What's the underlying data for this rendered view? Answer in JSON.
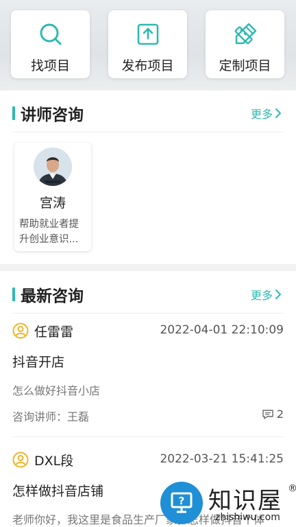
{
  "quick_actions": [
    {
      "label": "找项目",
      "icon": "search-icon"
    },
    {
      "label": "发布项目",
      "icon": "upload-icon"
    },
    {
      "label": "定制项目",
      "icon": "pencil-ruler-icon"
    }
  ],
  "teacher_section": {
    "title": "讲师咨询",
    "more_label": "更多",
    "teachers": [
      {
        "name": "宫涛",
        "desc": "帮助就业者提升创业意识..."
      }
    ]
  },
  "latest_section": {
    "title": "最新咨询",
    "more_label": "更多",
    "items": [
      {
        "user": "任雷雷",
        "time": "2022-04-01 22:10:09",
        "topic": "抖音开店",
        "desc": "怎么做好抖音小店",
        "teacher_line": "咨询讲师：王磊",
        "comment_count": "2"
      },
      {
        "user": "DXL段",
        "time": "2022-03-21 15:41:25",
        "topic": "怎样做抖音店铺",
        "desc": "老师你好，我这里是食品生产厂家，怎样做抖音个体",
        "teacher_line": "",
        "comment_count": ""
      }
    ]
  },
  "watermark": {
    "text": "知识屋",
    "url": "zhishiwu.com",
    "reg": "®"
  },
  "colors": {
    "accent": "#2bb9b1",
    "user_icon": "#f0b323",
    "watermark_blue": "#1f8fd6"
  }
}
